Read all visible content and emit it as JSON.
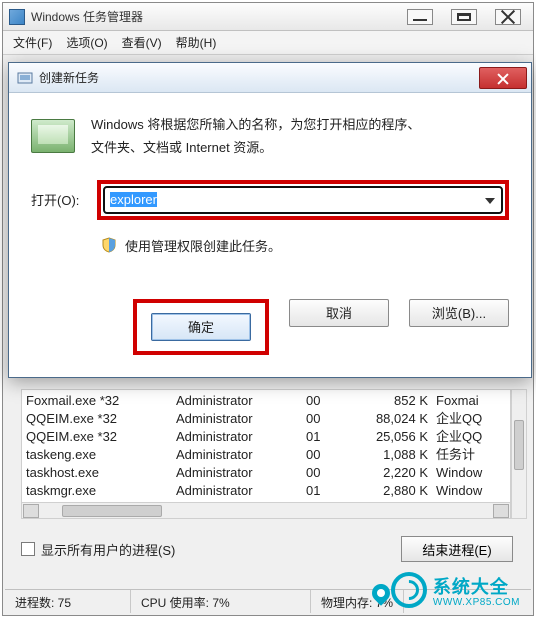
{
  "taskmgr": {
    "title": "Windows 任务管理器",
    "menu": {
      "file": "文件(F)",
      "options": "选项(O)",
      "view": "查看(V)",
      "help": "帮助(H)"
    },
    "show_all_users": "显示所有用户的进程(S)",
    "end_process": "结束进程(E)"
  },
  "dialog": {
    "title": "创建新任务",
    "desc1": "Windows 将根据您所输入的名称，为您打开相应的程序、",
    "desc2": "文件夹、文档或 Internet 资源。",
    "open_label": "打开(O):",
    "open_value": "explorer",
    "admin_note": "使用管理权限创建此任务。",
    "ok": "确定",
    "cancel": "取消",
    "browse": "浏览(B)..."
  },
  "processes": [
    {
      "name": "Foxmail.exe *32",
      "user": "Administrator",
      "cpu": "00",
      "mem": "852 K",
      "desc": "Foxmai"
    },
    {
      "name": "QQEIM.exe *32",
      "user": "Administrator",
      "cpu": "00",
      "mem": "88,024 K",
      "desc": "企业QQ"
    },
    {
      "name": "QQEIM.exe *32",
      "user": "Administrator",
      "cpu": "01",
      "mem": "25,056 K",
      "desc": "企业QQ"
    },
    {
      "name": "taskeng.exe",
      "user": "Administrator",
      "cpu": "00",
      "mem": "1,088 K",
      "desc": "任务计"
    },
    {
      "name": "taskhost.exe",
      "user": "Administrator",
      "cpu": "00",
      "mem": "2,220 K",
      "desc": "Window"
    },
    {
      "name": "taskmgr.exe",
      "user": "Administrator",
      "cpu": "01",
      "mem": "2,880 K",
      "desc": "Window"
    }
  ],
  "status": {
    "procs": "进程数: 75",
    "cpu": "CPU 使用率: 7%",
    "mem": "物理内存: 7%"
  },
  "watermark": {
    "cn": "系统大全",
    "en": "WWW.XP85.COM"
  },
  "colors": {
    "highlight": "#d00000",
    "accent": "#00a8c6"
  }
}
